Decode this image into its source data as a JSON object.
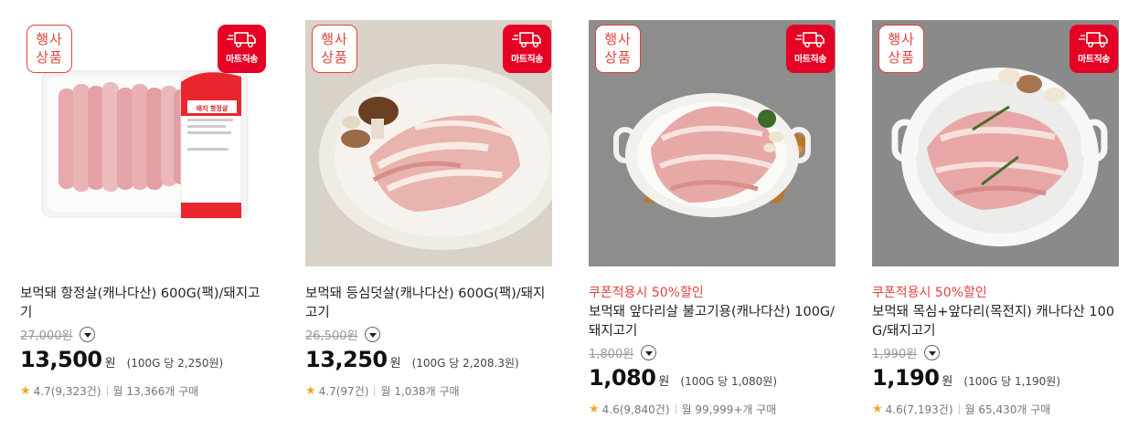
{
  "products": [
    {
      "event_badge": [
        "행사",
        "상품"
      ],
      "delivery_badge": "마트직송",
      "coupon": "",
      "name": "보먹돼 항정살(캐나다산) 600G(팩)/돼지고기",
      "original_price": "27,000원",
      "price": "13,500",
      "currency": "원",
      "unit_price": "(100G 당 2,250원)",
      "rating": "4.7(9,323건)",
      "monthly_purchases": "월 13,366개 구매",
      "label_text": "돼지 항정살",
      "image_subject": "packaged-pork-jowl"
    },
    {
      "event_badge": [
        "행사",
        "상품"
      ],
      "delivery_badge": "마트직송",
      "coupon": "",
      "name": "보먹돼 등심덧살(캐나다산) 600G(팩)/돼지고기",
      "original_price": "26,500원",
      "price": "13,250",
      "currency": "원",
      "unit_price": "(100G 당 2,208.3원)",
      "rating": "4.7(97건)",
      "monthly_purchases": "월 1,038개 구매",
      "image_subject": "pork-on-plate-with-mushrooms"
    },
    {
      "event_badge": [
        "행사",
        "상품"
      ],
      "delivery_badge": "마트직송",
      "coupon": "쿠폰적용시 50%할인",
      "name": "보먹돼 앞다리살 불고기용(캐나다산) 100G/돼지고기",
      "original_price": "1,800원",
      "price": "1,080",
      "currency": "원",
      "unit_price": "(100G 당 1,080원)",
      "rating": "4.6(9,840건)",
      "monthly_purchases": "월 99,999+개 구매",
      "image_subject": "sliced-pork-on-board"
    },
    {
      "event_badge": [
        "행사",
        "상품"
      ],
      "delivery_badge": "마트직송",
      "coupon": "쿠폰적용시 50%할인",
      "name": "보먹돼 목심+앞다리(목전지) 캐나다산 100G/돼지고기",
      "original_price": "1,990원",
      "price": "1,190",
      "currency": "원",
      "unit_price": "(100G 당 1,190원)",
      "rating": "4.6(7,193건)",
      "monthly_purchases": "월 65,430개 구매",
      "image_subject": "pork-shoulder-with-rosemary"
    }
  ],
  "colors": {
    "accent_red": "#e0443e",
    "delivery_red": "#e60023",
    "star": "#f5a623"
  },
  "icons": {
    "delivery": "truck-icon",
    "expand": "chevron-down-icon",
    "rating": "star-icon"
  }
}
